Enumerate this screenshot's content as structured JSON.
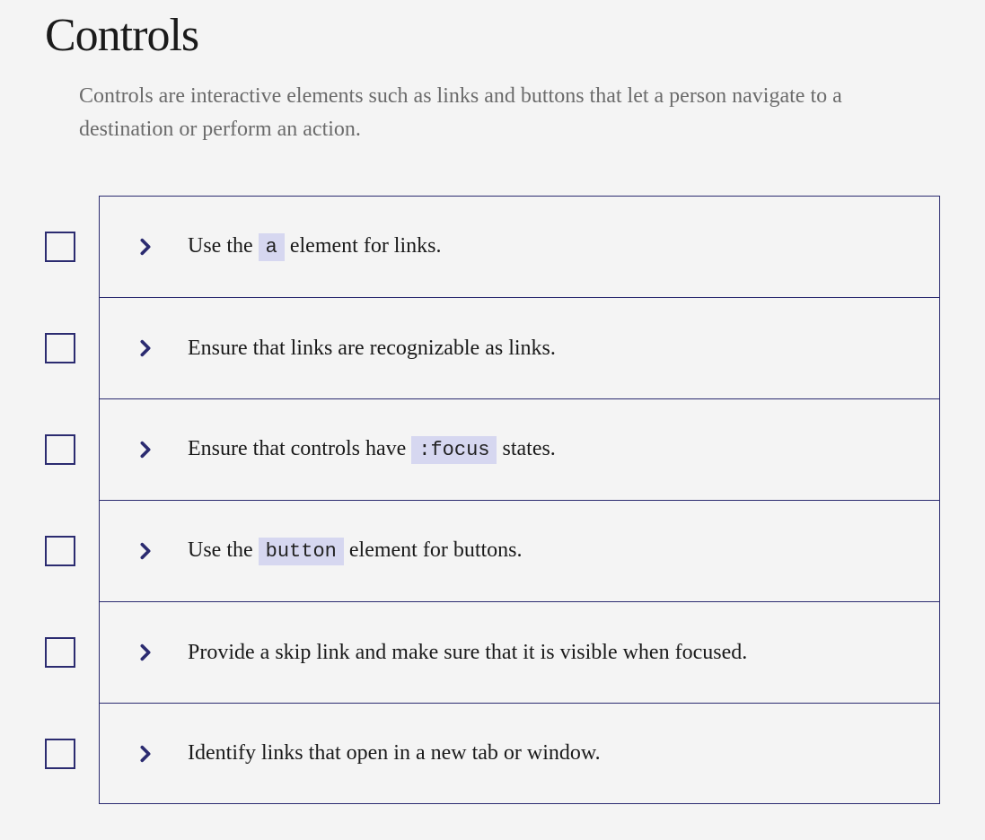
{
  "heading": "Controls",
  "description": "Controls are interactive elements such as links and buttons that let a person navigate to a destination or perform an action.",
  "items": [
    {
      "segments": [
        {
          "t": "text",
          "v": "Use the "
        },
        {
          "t": "code",
          "v": "a"
        },
        {
          "t": "text",
          "v": " element for links."
        }
      ]
    },
    {
      "segments": [
        {
          "t": "text",
          "v": "Ensure that links are recognizable as links."
        }
      ]
    },
    {
      "segments": [
        {
          "t": "text",
          "v": "Ensure that controls have "
        },
        {
          "t": "code",
          "v": ":focus"
        },
        {
          "t": "text",
          "v": " states."
        }
      ]
    },
    {
      "segments": [
        {
          "t": "text",
          "v": "Use the "
        },
        {
          "t": "code",
          "v": "button"
        },
        {
          "t": "text",
          "v": " element for buttons."
        }
      ]
    },
    {
      "segments": [
        {
          "t": "text",
          "v": "Provide a skip link and make sure that it is visible when focused."
        }
      ]
    },
    {
      "segments": [
        {
          "t": "text",
          "v": "Identify links that open in a new tab or window."
        }
      ]
    }
  ]
}
